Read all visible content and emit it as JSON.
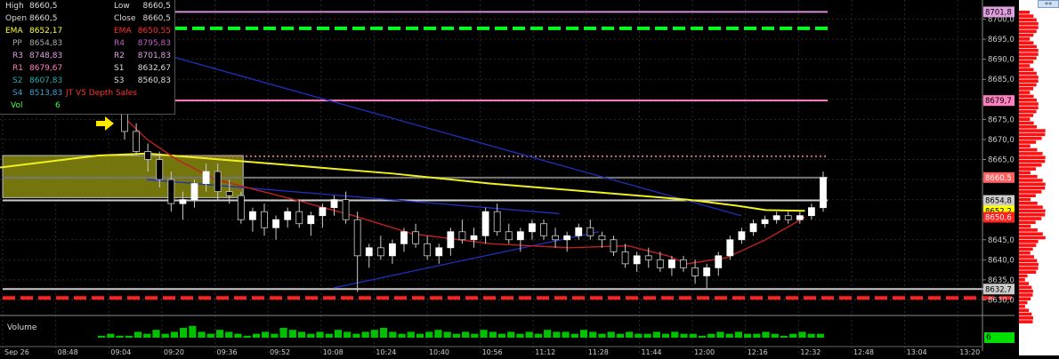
{
  "info_panel": {
    "rows": [
      {
        "left_label": "High",
        "left_value": "8660,5",
        "right_label": "Low",
        "right_value": "8660,5",
        "left_color": "#dddddd",
        "right_color": "#dddddd"
      },
      {
        "left_label": "Open",
        "left_value": "8660,5",
        "right_label": "Close",
        "right_value": "8660,5",
        "left_color": "#dddddd",
        "right_color": "#dddddd"
      },
      {
        "left_label": "EMA",
        "left_value": "8652,17",
        "right_label": "EMA",
        "right_value": "8650,55",
        "left_color": "#ffff33",
        "right_color": "#ff3030"
      },
      {
        "left_label": "PP",
        "left_value": "8654,83",
        "right_label": "R4",
        "right_value": "8795,83",
        "left_color": "#aaaaaa",
        "right_color": "#c060c0"
      },
      {
        "left_label": "R3",
        "left_value": "8748,83",
        "right_label": "R2",
        "right_value": "8701,83",
        "left_color": "#e0a0e0",
        "right_color": "#e0a0e0"
      },
      {
        "left_label": "R1",
        "left_value": "8679,67",
        "right_label": "S1",
        "right_value": "8632,67",
        "left_color": "#ff80c0",
        "right_color": "#dddddd"
      },
      {
        "left_label": "S2",
        "left_value": "8607,83",
        "right_label": "S3",
        "right_value": "8560,83",
        "left_color": "#20b0b0",
        "right_color": "#dddddd"
      },
      {
        "left_label": "S4",
        "left_value": "8513,83",
        "right_label": "JT V5 Depth Sales",
        "right_value": "",
        "left_color": "#40a0d0",
        "right_color": "#ff3030"
      },
      {
        "left_label": "Vol",
        "left_value": "6",
        "right_label": "",
        "right_value": "",
        "left_color": "#40ff40",
        "right_color": "#dddddd"
      }
    ]
  },
  "volume_label": "Volume",
  "volume_value": "6",
  "scroll_button": "««",
  "colors": {
    "background": "#000000",
    "grid": "#3a3a3a",
    "axis_text": "#cccccc",
    "ema_fast": "#f0f020",
    "ema_slow": "#c02020",
    "zone": "#8a8a10",
    "level_pink": "#d090d0",
    "level_green": "#00ff20",
    "level_red": "#ff2020",
    "up_candle": "#ffffff",
    "down_candle": "#000000",
    "volume": "#00c000",
    "trendline": "#2030c0"
  },
  "chart_data": {
    "type": "candlestick",
    "y_ticks": [
      "8700,0",
      "8695,0",
      "8690,0",
      "8685,0",
      "8680,0",
      "8675,0",
      "8670,0",
      "8665,0",
      "8660,0",
      "8655,0",
      "8650,0",
      "8645,0",
      "8640,0",
      "8635,0",
      "8630,0"
    ],
    "ylim": [
      8629,
      8703
    ],
    "x_ticks": [
      "Sep 26",
      "08:48",
      "09:04",
      "09:20",
      "09:36",
      "09:52",
      "10:08",
      "10:24",
      "10:40",
      "10:56",
      "11:12",
      "11:28",
      "11:44",
      "12:00",
      "12:16",
      "12:32",
      "12:48",
      "13:04",
      "13:20"
    ],
    "price_tags": [
      {
        "label": "8701,8",
        "value": 8701.8,
        "bg": "#e0a0e0",
        "fg": "#000000"
      },
      {
        "label": "8679,7",
        "value": 8679.7,
        "bg": "#ff80c0",
        "fg": "#000000"
      },
      {
        "label": "8660,5",
        "value": 8660.5,
        "bg": "#ff6060",
        "fg": "#ffffff"
      },
      {
        "label": "8654,8",
        "value": 8654.8,
        "bg": "#cccccc",
        "fg": "#000000"
      },
      {
        "label": "8652,2",
        "value": 8652.2,
        "bg": "#ffff00",
        "fg": "#000000"
      },
      {
        "label": "8650,6",
        "value": 8650.6,
        "bg": "#ff2020",
        "fg": "#ffffff"
      },
      {
        "label": "8632,7",
        "value": 8632.7,
        "bg": "#cccccc",
        "fg": "#000000"
      }
    ],
    "levels": [
      {
        "value": 8701.8,
        "color": "#d090d0",
        "style": "solid"
      },
      {
        "value": 8697.7,
        "color": "#00ff20",
        "style": "dash"
      },
      {
        "value": 8679.7,
        "color": "#ff80c0",
        "style": "solid"
      },
      {
        "value": 8665.8,
        "color": "#c07070",
        "style": "dot"
      },
      {
        "value": 8660.5,
        "color": "#777777",
        "style": "solid"
      },
      {
        "value": 8654.8,
        "color": "#cccccc",
        "style": "solid"
      },
      {
        "value": 8632.7,
        "color": "#cccccc",
        "style": "solid"
      },
      {
        "value": 8630.5,
        "color": "#ff2020",
        "style": "dash"
      }
    ],
    "zone": {
      "y_top": 8666,
      "y_bottom": 8655.5,
      "x_start": 0,
      "x_end": 0.245
    },
    "ema_fast": [
      [
        0,
        8663
      ],
      [
        0.05,
        8664.5
      ],
      [
        0.1,
        8666
      ],
      [
        0.15,
        8666.5
      ],
      [
        0.2,
        8665.5
      ],
      [
        0.3,
        8663.5
      ],
      [
        0.4,
        8661.5
      ],
      [
        0.5,
        8659
      ],
      [
        0.6,
        8657
      ],
      [
        0.7,
        8655
      ],
      [
        0.75,
        8653.5
      ],
      [
        0.78,
        8652.4
      ],
      [
        0.82,
        8652.2
      ]
    ],
    "ema_slow": [
      [
        0.12,
        8677
      ],
      [
        0.15,
        8670
      ],
      [
        0.18,
        8665
      ],
      [
        0.22,
        8660
      ],
      [
        0.3,
        8655
      ],
      [
        0.36,
        8651
      ],
      [
        0.42,
        8646.5
      ],
      [
        0.5,
        8644
      ],
      [
        0.58,
        8643
      ],
      [
        0.64,
        8643.5
      ],
      [
        0.68,
        8641
      ],
      [
        0.7,
        8639
      ],
      [
        0.74,
        8640.5
      ],
      [
        0.78,
        8645
      ],
      [
        0.82,
        8650.6
      ]
    ],
    "trendlines": [
      [
        [
          0.17,
          8691
        ],
        [
          0.755,
          8651
        ]
      ],
      [
        [
          0.15,
          8660
        ],
        [
          0.57,
          8651.5
        ]
      ],
      [
        [
          0.34,
          8633
        ],
        [
          0.61,
          8647
        ]
      ]
    ],
    "candles": [
      [
        8678,
        8680,
        8670,
        8672
      ],
      [
        8672,
        8674,
        8666,
        8667
      ],
      [
        8667,
        8669,
        8662,
        8665
      ],
      [
        8665,
        8667,
        8658,
        8660
      ],
      [
        8660,
        8662,
        8652,
        8654
      ],
      [
        8654,
        8657,
        8650,
        8655
      ],
      [
        8655,
        8660,
        8653,
        8659
      ],
      [
        8659,
        8664,
        8657,
        8662
      ],
      [
        8662,
        8664,
        8655,
        8657
      ],
      [
        8657,
        8660,
        8654,
        8656
      ],
      [
        8656,
        8657,
        8649,
        8650
      ],
      [
        8650,
        8653,
        8647,
        8652
      ],
      [
        8652,
        8654,
        8646,
        8648
      ],
      [
        8648,
        8651,
        8645,
        8650
      ],
      [
        8650,
        8653,
        8648,
        8652
      ],
      [
        8652,
        8655,
        8648,
        8649
      ],
      [
        8649,
        8652,
        8646,
        8651
      ],
      [
        8651,
        8654,
        8648,
        8653
      ],
      [
        8653,
        8656,
        8651,
        8655
      ],
      [
        8655,
        8657,
        8649,
        8650
      ],
      [
        8650,
        8652,
        8632,
        8641
      ],
      [
        8641,
        8644,
        8638,
        8643
      ],
      [
        8643,
        8646,
        8640,
        8641
      ],
      [
        8641,
        8645,
        8639,
        8644
      ],
      [
        8644,
        8648,
        8642,
        8647
      ],
      [
        8647,
        8649,
        8643,
        8644
      ],
      [
        8644,
        8646,
        8640,
        8641
      ],
      [
        8641,
        8644,
        8639,
        8643
      ],
      [
        8643,
        8648,
        8641,
        8647
      ],
      [
        8647,
        8650,
        8644,
        8645
      ],
      [
        8645,
        8648,
        8643,
        8646
      ],
      [
        8646,
        8653,
        8644,
        8652
      ],
      [
        8652,
        8654,
        8646,
        8647
      ],
      [
        8647,
        8649,
        8644,
        8645
      ],
      [
        8645,
        8648,
        8642,
        8647
      ],
      [
        8647,
        8650,
        8645,
        8649
      ],
      [
        8649,
        8650,
        8645,
        8646
      ],
      [
        8646,
        8648,
        8643,
        8645
      ],
      [
        8645,
        8647,
        8642,
        8646
      ],
      [
        8646,
        8649,
        8645,
        8648
      ],
      [
        8648,
        8650,
        8645,
        8646
      ],
      [
        8646,
        8647,
        8643,
        8645
      ],
      [
        8645,
        8646,
        8641,
        8642
      ],
      [
        8642,
        8644,
        8638,
        8639
      ],
      [
        8639,
        8642,
        8637,
        8641
      ],
      [
        8641,
        8643,
        8638,
        8640
      ],
      [
        8640,
        8642,
        8637,
        8638
      ],
      [
        8638,
        8641,
        8636,
        8640
      ],
      [
        8640,
        8641,
        8637,
        8638
      ],
      [
        8638,
        8640,
        8634,
        8636
      ],
      [
        8636,
        8639,
        8633,
        8638
      ],
      [
        8638,
        8642,
        8636,
        8641
      ],
      [
        8641,
        8646,
        8640,
        8645
      ],
      [
        8645,
        8648,
        8644,
        8647
      ],
      [
        8647,
        8650,
        8646,
        8649
      ],
      [
        8649,
        8651,
        8648,
        8650
      ],
      [
        8650,
        8652,
        8649,
        8651
      ],
      [
        8651,
        8652,
        8649,
        8650
      ],
      [
        8650,
        8652,
        8649,
        8651
      ],
      [
        8651,
        8654,
        8650,
        8653
      ],
      [
        8653,
        8662,
        8652,
        8660.5
      ]
    ],
    "volumes": [
      1,
      2,
      1,
      1,
      3,
      2,
      4,
      2,
      3,
      5,
      6,
      3,
      2,
      4,
      3,
      2,
      1,
      2,
      3,
      2,
      5,
      4,
      3,
      2,
      3,
      2,
      4,
      3,
      2,
      3,
      4,
      5,
      3,
      2,
      3,
      2,
      3,
      4,
      3,
      2,
      3,
      2,
      4,
      3,
      2,
      3,
      2,
      3,
      2,
      4,
      3,
      3,
      2,
      4,
      3,
      2,
      3,
      2,
      3,
      2,
      2,
      3,
      2,
      3,
      2,
      2,
      1,
      2,
      3,
      2,
      3,
      2,
      2,
      3,
      2,
      1,
      2,
      3,
      2,
      2
    ]
  }
}
